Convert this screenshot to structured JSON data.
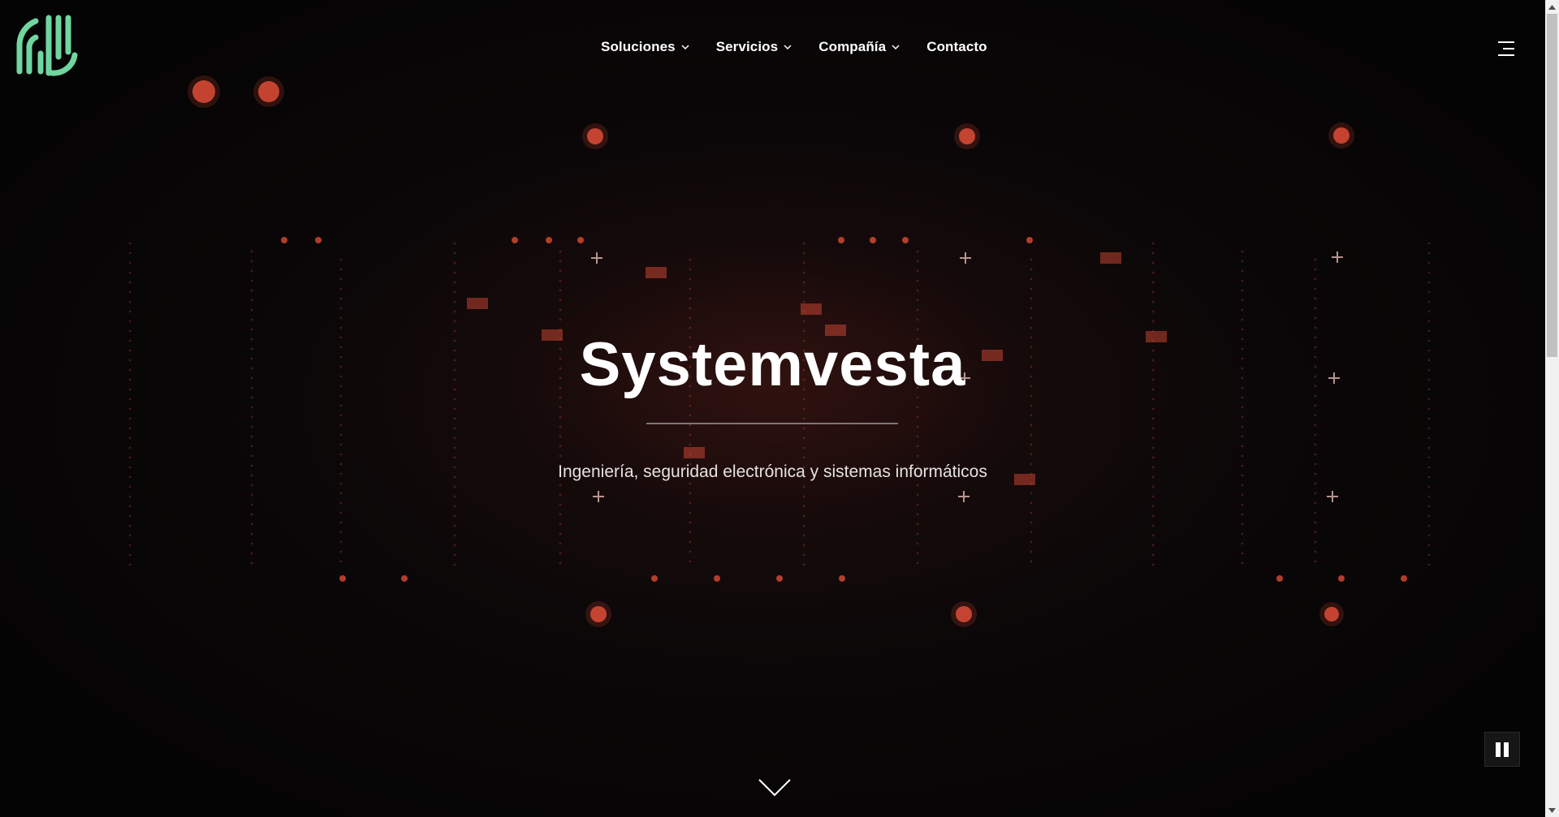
{
  "site": {
    "brand_color": "#6fd6a0",
    "accent_color": "#e8503a"
  },
  "nav": {
    "items": [
      {
        "label": "Soluciones",
        "has_dropdown": true
      },
      {
        "label": "Servicios",
        "has_dropdown": true
      },
      {
        "label": "Compañía",
        "has_dropdown": true
      },
      {
        "label": "Contacto",
        "has_dropdown": false
      }
    ],
    "menu_icon": "hamburger-icon"
  },
  "hero": {
    "title": "Systemvesta",
    "subtitle": "Ingeniería, seguridad electrónica y sistemas informáticos",
    "scroll_icon": "chevron-down-icon",
    "video_control_icon": "pause-icon"
  }
}
